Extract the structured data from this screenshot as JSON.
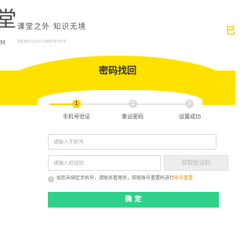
{
  "header": {
    "logo_char": "堂",
    "logo_sub": "M",
    "slogan": "课堂之外 知识无境",
    "slogan_sub": "我是课程大全全补 外课堂优质学在线",
    "corner_text": "已"
  },
  "page_title": "密码找回",
  "steps": [
    {
      "number": "1",
      "label": "手机号验证",
      "status": "active"
    },
    {
      "number": "2",
      "label": "重设密码",
      "status": "pending"
    },
    {
      "number": "3",
      "label": "设置成功",
      "status": "pending"
    }
  ],
  "form": {
    "phone_placeholder": "请输入手机号",
    "code_placeholder": "请输入验证码",
    "code_button": "获取验证码",
    "note_icon": "!",
    "note_text": "如您未绑定手机号，请联系管理员，获取账号重置码进行",
    "note_link": "账号重置",
    "confirm_button": "确 定"
  },
  "colors": {
    "accent_yellow": "#ffe100",
    "confirm_green": "#2fd08a",
    "link_orange": "#ff8c00"
  }
}
